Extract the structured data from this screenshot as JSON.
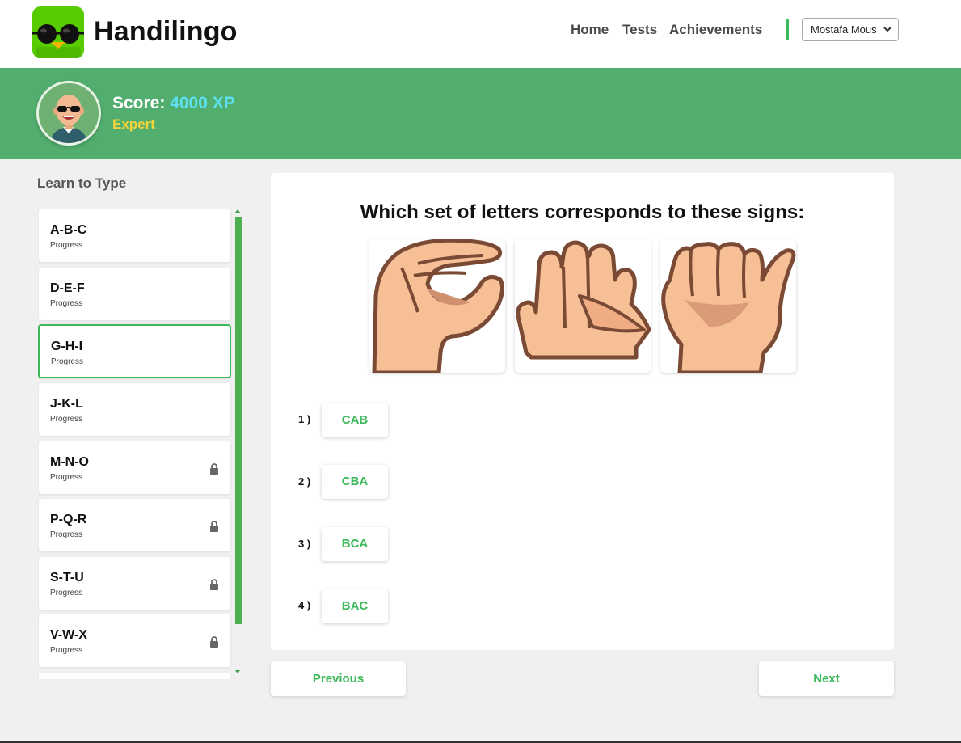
{
  "app": {
    "name": "Handilingo"
  },
  "nav": {
    "items": [
      "Home",
      "Tests",
      "Achievements"
    ]
  },
  "user": {
    "selected": "Mostafa Mous"
  },
  "profile": {
    "score_label": "Score:",
    "score_value": "4000 XP",
    "rank": "Expert"
  },
  "sidebar": {
    "title": "Learn to Type",
    "lessons": [
      {
        "name": "A-B-C",
        "sub": "Progress",
        "locked": false
      },
      {
        "name": "D-E-F",
        "sub": "Progress",
        "locked": false
      },
      {
        "name": "G-H-I",
        "sub": "Progress",
        "locked": false,
        "active": true
      },
      {
        "name": "J-K-L",
        "sub": "Progress",
        "locked": false
      },
      {
        "name": "M-N-O",
        "sub": "Progress",
        "locked": true
      },
      {
        "name": "P-Q-R",
        "sub": "Progress",
        "locked": true
      },
      {
        "name": "S-T-U",
        "sub": "Progress",
        "locked": true
      },
      {
        "name": "V-W-X",
        "sub": "Progress",
        "locked": true
      }
    ]
  },
  "quiz": {
    "question": "Which set of letters corresponds to these signs:",
    "signs": [
      "hand-sign-c",
      "hand-sign-a",
      "hand-sign-b"
    ],
    "options": [
      {
        "num": "1 )",
        "label": "CAB"
      },
      {
        "num": "2 )",
        "label": "CBA"
      },
      {
        "num": "3 )",
        "label": "BCA"
      },
      {
        "num": "4 )",
        "label": "BAC"
      }
    ]
  },
  "buttons": {
    "previous": "Previous",
    "next": "Next"
  },
  "colors": {
    "accent": "#3cb95a",
    "banner": "#52ae6e",
    "score": "#5ee0f0",
    "rank": "#f5d33a"
  }
}
